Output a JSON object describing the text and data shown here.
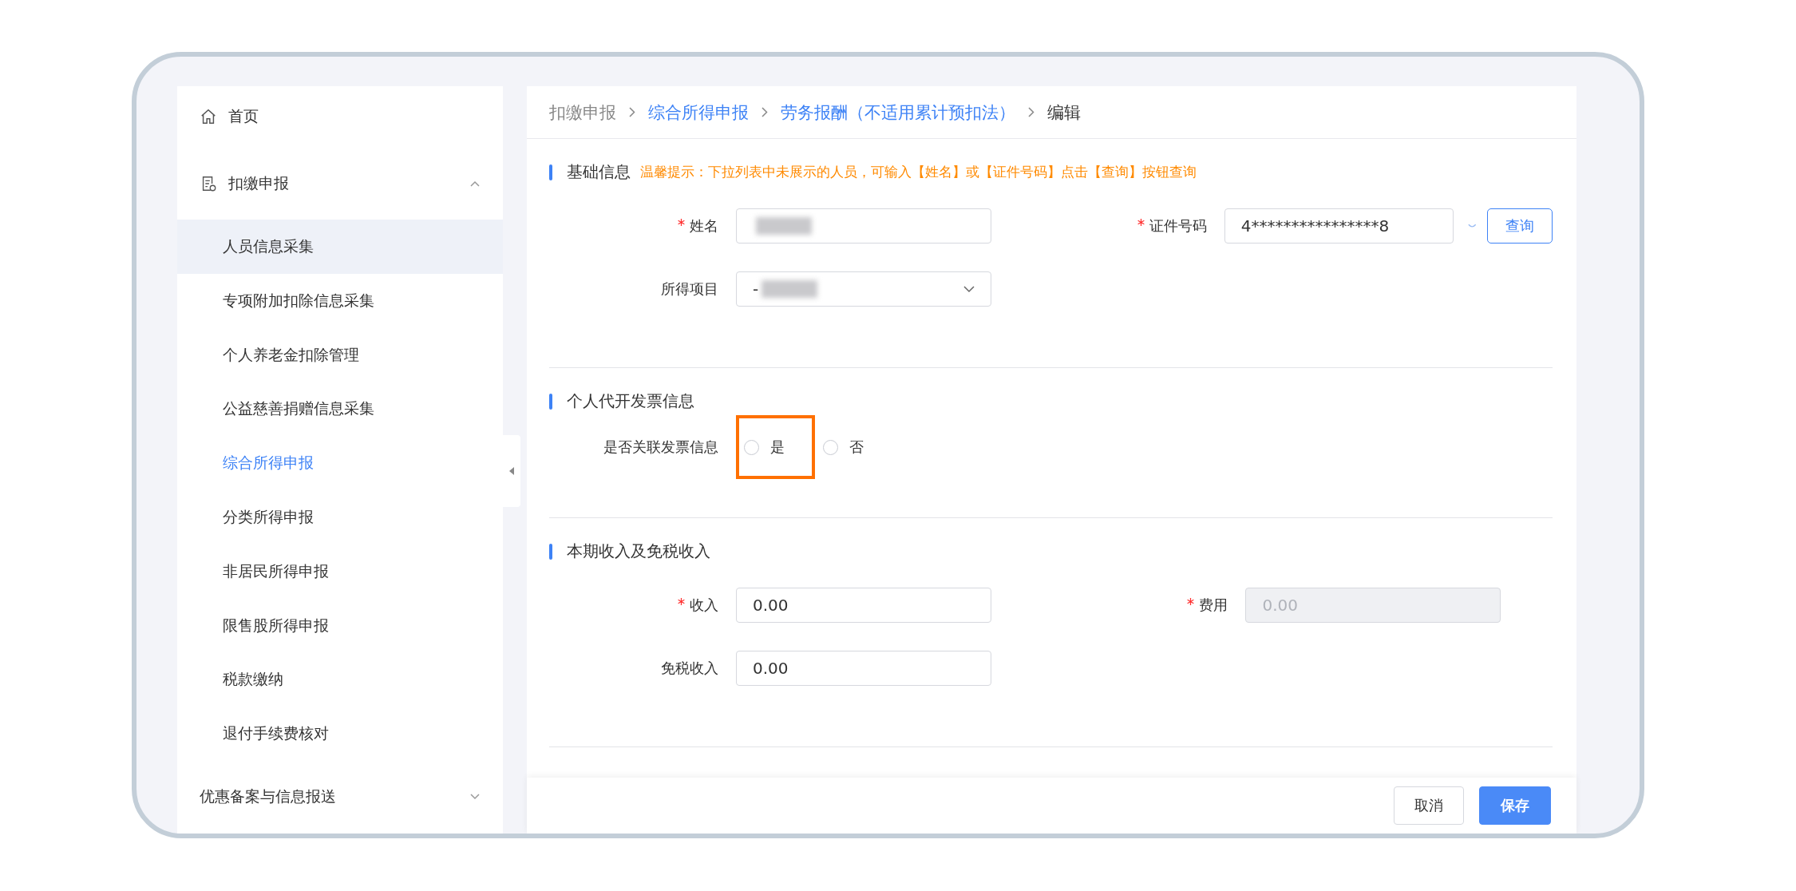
{
  "sidebar": {
    "items": [
      {
        "label": "首页",
        "kind": "top"
      },
      {
        "label": "扣缴申报",
        "kind": "group",
        "expanded": true,
        "children": [
          {
            "label": "人员信息采集",
            "selected": false,
            "hovered": true
          },
          {
            "label": "专项附加扣除信息采集",
            "selected": false,
            "hovered": false
          },
          {
            "label": "个人养老金扣除管理",
            "selected": false,
            "hovered": false
          },
          {
            "label": "公益慈善捐赠信息采集",
            "selected": false,
            "hovered": false
          },
          {
            "label": "综合所得申报",
            "selected": true,
            "hovered": false
          },
          {
            "label": "分类所得申报",
            "selected": false,
            "hovered": false
          },
          {
            "label": "非居民所得申报",
            "selected": false,
            "hovered": false
          },
          {
            "label": "限售股所得申报",
            "selected": false,
            "hovered": false
          },
          {
            "label": "税款缴纳",
            "selected": false,
            "hovered": false
          },
          {
            "label": "退付手续费核对",
            "selected": false,
            "hovered": false
          }
        ]
      },
      {
        "label": "优惠备案与信息报送",
        "kind": "group",
        "expanded": false
      }
    ]
  },
  "breadcrumb": [
    {
      "label": "扣缴申报",
      "link": false
    },
    {
      "label": "综合所得申报",
      "link": true
    },
    {
      "label": "劳务报酬（不适用累计预扣法）",
      "link": true
    },
    {
      "label": "编辑",
      "link": false
    }
  ],
  "sections": [
    {
      "title": "基础信息",
      "tip": "温馨提示：下拉列表中未展示的人员，可输入【姓名】或【证件号码】点击【查询】按钮查询",
      "rows": [
        [
          {
            "label": "姓名",
            "required": true,
            "kind": "input",
            "blurred": true,
            "disabled": false
          },
          {
            "label": "证件号码",
            "required": true,
            "kind": "input",
            "value": "4****************8",
            "blurred": false,
            "disabled": false,
            "button": "查询"
          }
        ],
        [
          {
            "label": "所得项目",
            "required": false,
            "kind": "select",
            "value": "-",
            "blurred": true,
            "disabled": false
          }
        ]
      ]
    },
    {
      "title": "个人代开发票信息",
      "rows": [
        [
          {
            "label": "是否关联发票信息",
            "required": false,
            "kind": "radio",
            "options": [
              {
                "label": "是",
                "selected": false,
                "highlighted": true
              },
              {
                "label": "否",
                "selected": false,
                "highlighted": false
              }
            ]
          }
        ]
      ]
    },
    {
      "title": "本期收入及免税收入",
      "rows": [
        [
          {
            "label": "收入",
            "required": true,
            "kind": "input",
            "value": "0.00",
            "blurred": false,
            "disabled": false
          },
          {
            "label": "费用",
            "required": true,
            "kind": "input",
            "value": "0.00",
            "blurred": false,
            "disabled": true
          }
        ],
        [
          {
            "label": "免税收入",
            "required": false,
            "kind": "input",
            "value": "0.00",
            "blurred": false,
            "disabled": false
          }
        ]
      ]
    }
  ],
  "footer": {
    "buttons": [
      {
        "label": "取消",
        "kind": "default"
      },
      {
        "label": "保存",
        "kind": "primary"
      }
    ]
  }
}
